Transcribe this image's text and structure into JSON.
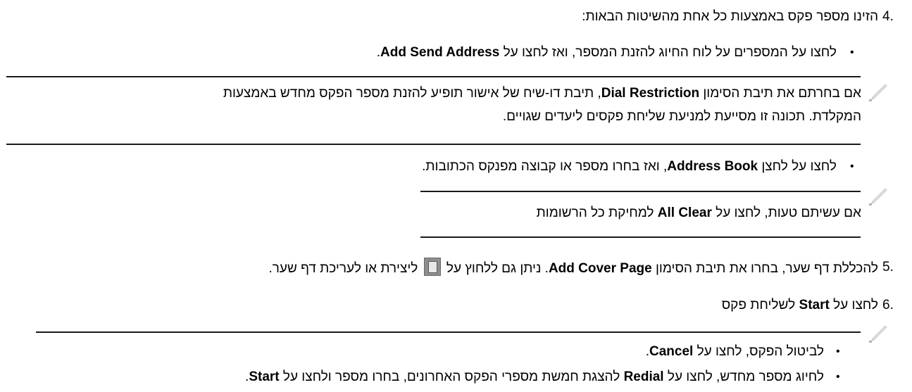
{
  "step4": {
    "number": "4.",
    "text": "הזינו מספר פקס באמצעות כל אחת מהשיטות הבאות:",
    "bullet1": {
      "a": "לחצו על המספרים על לוח החיוג להזנת המספר, ואז לחצו על ",
      "b": "Add Send Address",
      "c": "."
    },
    "note1": {
      "icon": "pencil-note-icon",
      "l1a": "אם בחרתם את תיבת הסימון ",
      "l1b": "Dial Restriction",
      "l1c": ", תיבת דו-שיח של אישור תופיע להזנת מספר הפקס מחדש באמצעות",
      "l2": "המקלדת. תכונה זו מסייעת למניעת שליחת פקסים ליעדים שגויים."
    },
    "bullet2": {
      "a": "לחצו על לחצן ",
      "b": "Address Book",
      "c": ", ואז בחרו מספר או קבוצה מפנקס הכתובות."
    },
    "note2": {
      "icon": "pencil-note-icon",
      "a": "אם עשיתם טעות, לחצו על ",
      "b": "All Clear",
      "c": " למחיקת כל הרשומות"
    }
  },
  "step5": {
    "number": "5.",
    "a": "להכללת דף שער, בחרו את תיבת הסימון ",
    "b": "Add Cover Page",
    "c": ". ניתן גם ללחוץ על ",
    "icon": "cover-page-icon",
    "d": " ליצירת או לעריכת דף שער."
  },
  "step6": {
    "number": "6.",
    "a": "לחצו על ",
    "b": "Start",
    "c": " לשליחת פקס",
    "note": {
      "icon": "pencil-note-icon",
      "bullet1": {
        "a": "לביטול הפקס, לחצו על ",
        "b": "Cancel",
        "c": "."
      },
      "bullet2": {
        "a": "לחיוג מספר מחדש, לחצו על ",
        "b": "Redial",
        "c": " להצגת חמשת מספרי הפקס האחרונים, בחרו מספר ולחצו על ",
        "d": "Start",
        "e": "."
      }
    }
  },
  "bullet_char": "•"
}
